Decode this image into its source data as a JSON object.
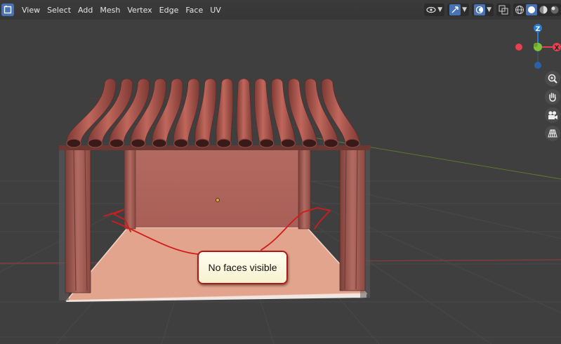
{
  "header": {
    "menus": [
      "View",
      "Select",
      "Add",
      "Mesh",
      "Vertex",
      "Edge",
      "Face",
      "UV"
    ]
  },
  "gizmo": {
    "z_label": "Z",
    "x_label": "X",
    "colors": {
      "x": "#e8404e",
      "y": "#7cc33b",
      "z": "#2a7dd1"
    }
  },
  "nav_icons": [
    "zoom-icon",
    "hand-pan-icon",
    "camera-icon",
    "grid-perspective-icon"
  ],
  "callout": {
    "text": "No faces visible"
  },
  "colors": {
    "accent": "#4772b3",
    "annotation": "#d01c1c",
    "roof_tile": "#a55248",
    "back_wall": "#b86f66",
    "floor": "#e2a48c"
  }
}
